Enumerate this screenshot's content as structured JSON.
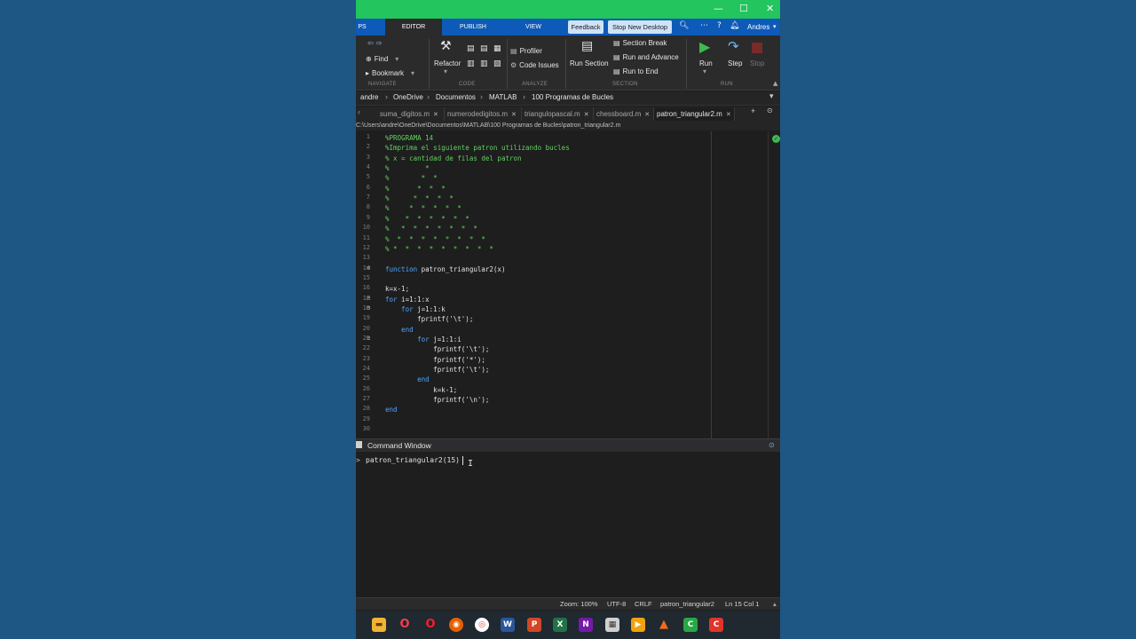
{
  "window": {
    "minimize_glyph": "—",
    "maximize_glyph": "☐",
    "close_glyph": "✕"
  },
  "ribbon_tabs": {
    "partial": "PS",
    "editor": "EDITOR",
    "publish": "PUBLISH",
    "view": "VIEW"
  },
  "top_right": {
    "feedback": "Feedback",
    "stop_new_desktop": "Stop New Desktop",
    "user": "Andres"
  },
  "ribbon": {
    "navigate": {
      "find": "Find",
      "bookmark": "Bookmark",
      "group_label": "NAVIGATE"
    },
    "code": {
      "refactor": "Refactor",
      "group_label": "CODE"
    },
    "analyze": {
      "profiler": "Profiler",
      "code_issues": "Code Issues",
      "group_label": "ANALYZE"
    },
    "section": {
      "run_section": "Run Section",
      "section_break": "Section Break",
      "run_and_advance": "Run and Advance",
      "run_to_end": "Run to End",
      "group_label": "SECTION"
    },
    "run": {
      "run": "Run",
      "step": "Step",
      "stop": "Stop",
      "group_label": "RUN"
    }
  },
  "breadcrumb": [
    "andre",
    "OneDrive",
    "Documentos",
    "MATLAB",
    "100 Programas de Bucles"
  ],
  "file_tabs": [
    {
      "label": "suma_digitos.m"
    },
    {
      "label": "numerodedigitos.m"
    },
    {
      "label": "triangulopascal.m"
    },
    {
      "label": "chessboard.m"
    },
    {
      "label": "patron_triangular2.m"
    }
  ],
  "file_path": "C:\\Users\\andre\\OneDrive\\Documentos\\MATLAB\\100 Programas de Bucles\\patron_triangular2.m",
  "code_lines": [
    {
      "n": "1",
      "text": "%PROGRAMA 14",
      "cls": "cm"
    },
    {
      "n": "2",
      "text": "%Imprima el siguiente patron utilizando bucles",
      "cls": "cm"
    },
    {
      "n": "3",
      "text": "% x = cantidad de filas del patron",
      "cls": "cm"
    },
    {
      "n": "4",
      "text": "%         *",
      "cls": "cm"
    },
    {
      "n": "5",
      "text": "%        *  *",
      "cls": "cm"
    },
    {
      "n": "6",
      "text": "%       *  *  *",
      "cls": "cm"
    },
    {
      "n": "7",
      "text": "%      *  *  *  *",
      "cls": "cm"
    },
    {
      "n": "8",
      "text": "%     *  *  *  *  *",
      "cls": "cm"
    },
    {
      "n": "9",
      "text": "%    *  *  *  *  *  *",
      "cls": "cm"
    },
    {
      "n": "10",
      "text": "%   *  *  *  *  *  *  *",
      "cls": "cm"
    },
    {
      "n": "11",
      "text": "%  *  *  *  *  *  *  *  *",
      "cls": "cm"
    },
    {
      "n": "12",
      "text": "% *  *  *  *  *  *  *  *  *",
      "cls": "cm"
    },
    {
      "n": "13",
      "text": "",
      "cls": "tx"
    },
    {
      "n": "14",
      "text": "function",
      "rest": " patron_triangular2(x)",
      "cls": "kw"
    },
    {
      "n": "15",
      "text": "",
      "cls": "tx"
    },
    {
      "n": "16",
      "text": "k=x-1;",
      "cls": "tx"
    },
    {
      "n": "17",
      "text": "for",
      "rest": " i=1:1:x",
      "cls": "kw"
    },
    {
      "n": "18",
      "text": "    for",
      "rest": " j=1:1:k",
      "cls": "kw"
    },
    {
      "n": "19",
      "text": "        fprintf('\\t');",
      "cls": "tx"
    },
    {
      "n": "20",
      "text": "    end",
      "cls": "kw"
    },
    {
      "n": "21",
      "text": "        for",
      "rest": " j=1:1:i",
      "cls": "kw"
    },
    {
      "n": "22",
      "text": "            fprintf('\\t');",
      "cls": "tx"
    },
    {
      "n": "23",
      "text": "            fprintf('*');",
      "cls": "tx"
    },
    {
      "n": "24",
      "text": "            fprintf('\\t');",
      "cls": "tx"
    },
    {
      "n": "25",
      "text": "        end",
      "cls": "kw"
    },
    {
      "n": "26",
      "text": "            k=k-1;",
      "cls": "tx"
    },
    {
      "n": "27",
      "text": "            fprintf('\\n');",
      "cls": "tx"
    },
    {
      "n": "28",
      "text": "end",
      "cls": "kw"
    },
    {
      "n": "29",
      "text": "",
      "cls": "tx"
    },
    {
      "n": "30",
      "text": "",
      "cls": "tx"
    }
  ],
  "command_window": {
    "title": "Command Window",
    "prompt": ">",
    "input": "patron_triangular2(15)"
  },
  "status_bar": {
    "zoom": "Zoom: 100%",
    "encoding": "UTF-8",
    "eol": "CRLF",
    "function": "patron_triangular2",
    "position": "Ln 15 Col 1"
  },
  "taskbar_icons": [
    "files-icon",
    "opera-gx-icon",
    "opera-icon",
    "firefox-icon",
    "chrome-icon",
    "word-icon",
    "powerpoint-icon",
    "excel-icon",
    "onenote-icon",
    "calculator-icon",
    "media-player-icon",
    "matlab-icon",
    "camtasia-icon",
    "recorder-icon"
  ]
}
